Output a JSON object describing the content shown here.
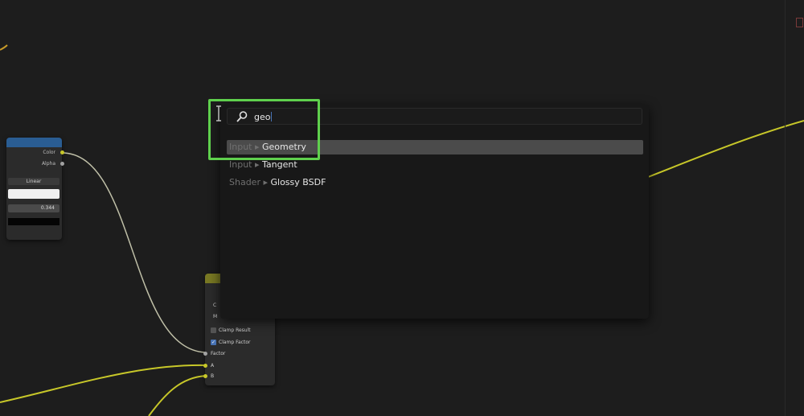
{
  "search": {
    "query": "geo",
    "results": [
      {
        "category": "Input",
        "separator": "▸",
        "name": "Geometry"
      },
      {
        "category": "Input",
        "separator": "▸",
        "name": "Tangent"
      },
      {
        "category": "Shader",
        "separator": "▸",
        "name": "Glossy BSDF"
      }
    ]
  },
  "texture_node": {
    "outputs": [
      "Color",
      "Alpha"
    ],
    "interpolation": "Linear",
    "position_value": "0.344"
  },
  "mix_node": {
    "clamp_result": "Clamp Result",
    "clamp_factor": "Clamp Factor",
    "inputs": [
      "Factor",
      "A",
      "B"
    ],
    "partial_labels": [
      "C",
      "M"
    ]
  },
  "colors": {
    "highlight": "#5fd04d",
    "wire": "#c7c729",
    "background": "#1d1d1d"
  }
}
